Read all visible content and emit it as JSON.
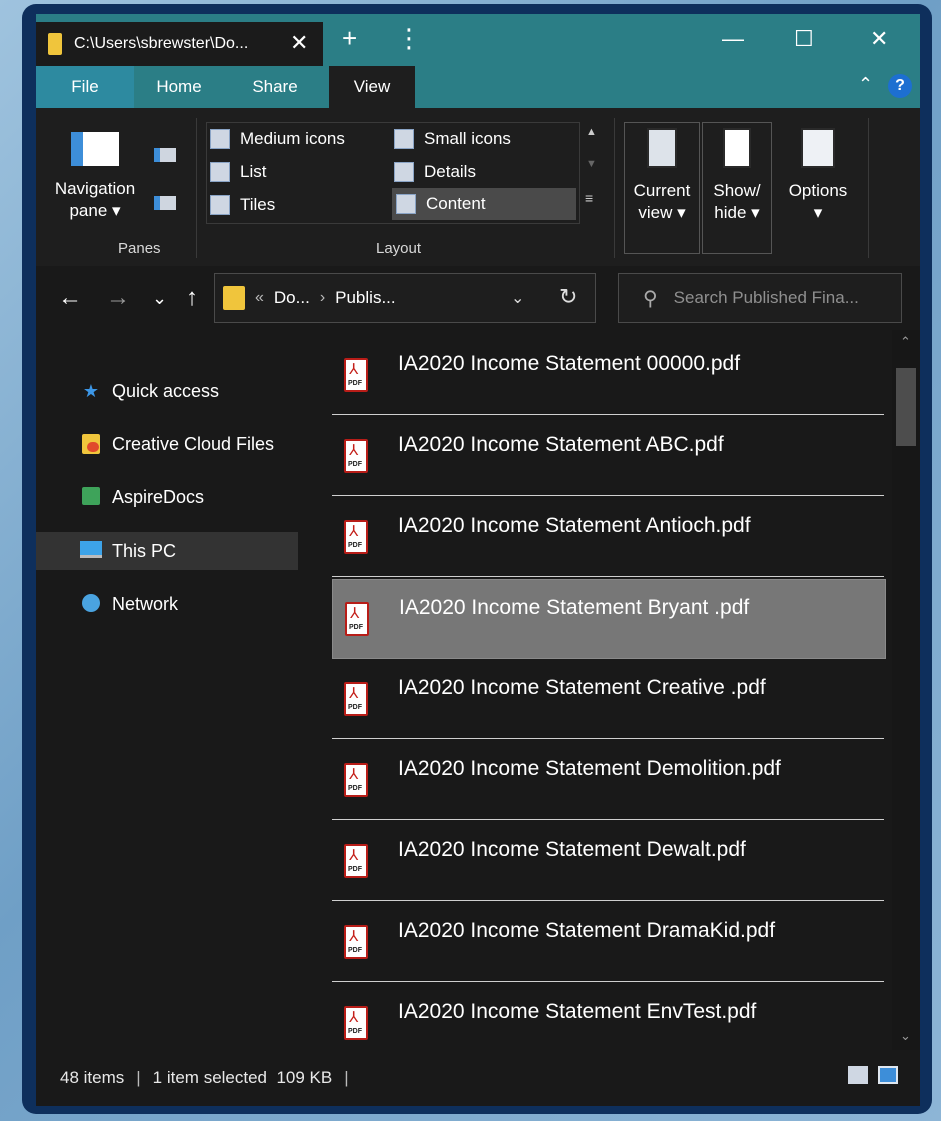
{
  "window": {
    "tab_title": "C:\\Users\\sbrewster\\Do...",
    "new_tab": "+",
    "tab_menu": "⋮",
    "minimize": "—",
    "maximize": "☐",
    "close": "✕",
    "tab_close": "✕"
  },
  "ribbon_tabs": [
    "File",
    "Home",
    "Share",
    "View"
  ],
  "ribbon": {
    "panes": {
      "navigation_pane_label": "Navigation pane ▾",
      "group_label": "Panes"
    },
    "layout": {
      "options": [
        {
          "label": "Medium icons",
          "selected": false
        },
        {
          "label": "Small icons",
          "selected": false
        },
        {
          "label": "List",
          "selected": false
        },
        {
          "label": "Details",
          "selected": false
        },
        {
          "label": "Tiles",
          "selected": false
        },
        {
          "label": "Content",
          "selected": true
        }
      ],
      "group_label": "Layout"
    },
    "current_view": "Current view ▾",
    "show_hide": "Show/ hide ▾",
    "options_label": "Options",
    "options_caret": "▾"
  },
  "nav": {
    "back": "←",
    "forward": "→",
    "recent": "⌄",
    "up": "↑",
    "breadcrumb": [
      "Do...",
      "Publis..."
    ],
    "breadcrumb_chevron": "«",
    "breadcrumb_sep": "›",
    "dropdown": "⌄",
    "refresh": "↻"
  },
  "search": {
    "placeholder": "Search Published Fina..."
  },
  "sidebar": {
    "items": [
      {
        "label": "Quick access",
        "icon": "star-icon",
        "selected": false
      },
      {
        "label": "Creative Cloud Files",
        "icon": "creative-cloud-folder-icon",
        "selected": false
      },
      {
        "label": "AspireDocs",
        "icon": "aspiredocs-icon",
        "selected": false
      },
      {
        "label": "This PC",
        "icon": "computer-icon",
        "selected": true
      },
      {
        "label": "Network",
        "icon": "network-icon",
        "selected": false
      }
    ]
  },
  "files": [
    {
      "name": "IA2020 Income Statement 00000.pdf",
      "selected": false
    },
    {
      "name": "IA2020 Income Statement ABC.pdf",
      "selected": false
    },
    {
      "name": "IA2020 Income Statement Antioch.pdf",
      "selected": false
    },
    {
      "name": "IA2020 Income Statement Bryant .pdf",
      "selected": true
    },
    {
      "name": "IA2020 Income Statement Creative .pdf",
      "selected": false
    },
    {
      "name": "IA2020 Income Statement Demolition.pdf",
      "selected": false
    },
    {
      "name": "IA2020 Income Statement Dewalt.pdf",
      "selected": false
    },
    {
      "name": "IA2020 Income Statement DramaKid.pdf",
      "selected": false
    },
    {
      "name": "IA2020 Income Statement EnvTest.pdf",
      "selected": false
    }
  ],
  "pdf_icon_label": "PDF",
  "status": {
    "items_count": "48 items",
    "selection": "1 item selected  109 KB",
    "separator": "|"
  },
  "colors": {
    "title_bar": "#2b7e86",
    "window_frame": "#0e2f5c",
    "background": "#191919",
    "selection": "#777777",
    "pdf_red": "#c4201a"
  }
}
